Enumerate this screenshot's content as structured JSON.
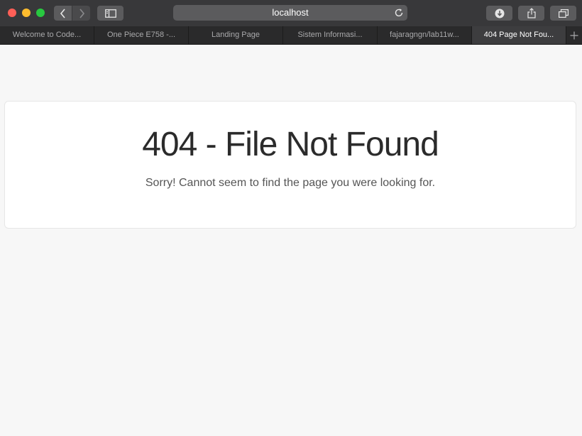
{
  "browser": {
    "address": "localhost",
    "tabs": [
      {
        "label": "Welcome to Code..."
      },
      {
        "label": "One Piece E758 -..."
      },
      {
        "label": "Landing Page"
      },
      {
        "label": "Sistem Informasi..."
      },
      {
        "label": "fajaragngn/lab11w..."
      },
      {
        "label": "404 Page Not Fou..."
      }
    ],
    "active_tab_index": 5,
    "colors": {
      "close": "#ff5f57",
      "minimize": "#febc2e",
      "maximize": "#28c840"
    }
  },
  "page": {
    "title": "404 - File Not Found",
    "message": "Sorry! Cannot seem to find the page you were looking for."
  }
}
